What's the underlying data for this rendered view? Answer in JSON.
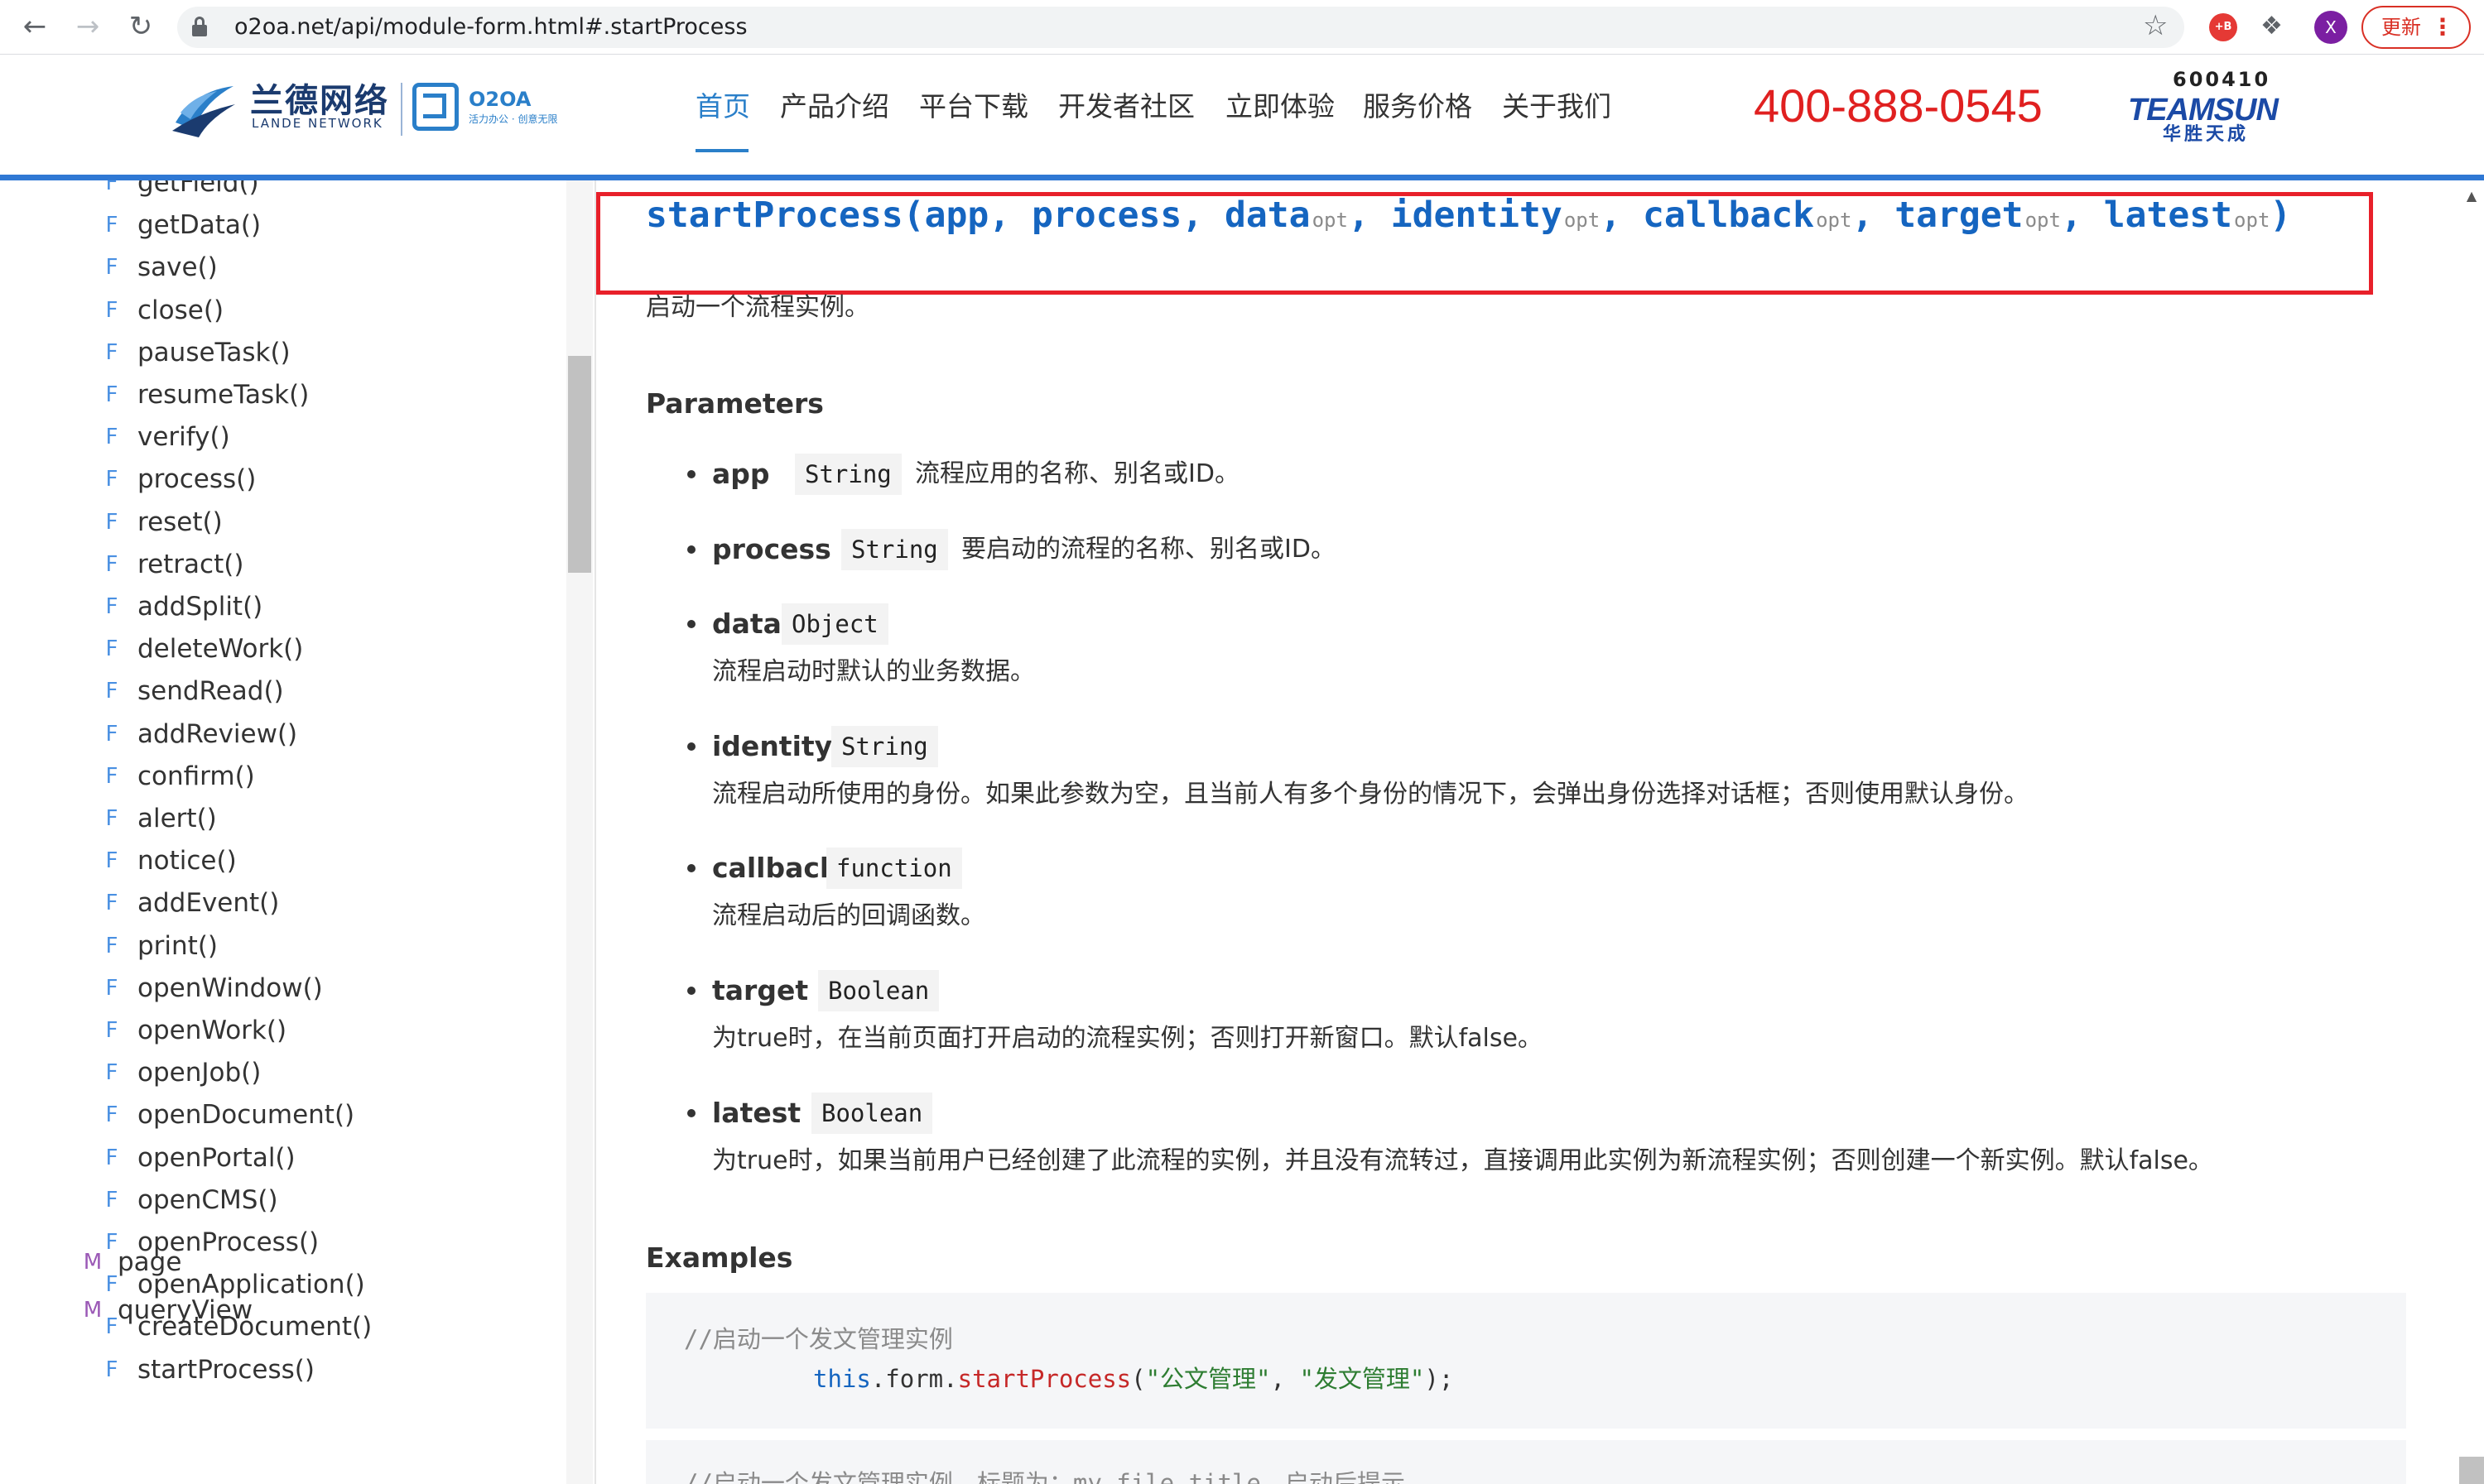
{
  "browser": {
    "url": "o2oa.net/api/module-form.html#.startProcess",
    "update_label": "更新",
    "profile_initial": "X",
    "extension_badge": "+B"
  },
  "site": {
    "logo_cn": "兰德网络",
    "logo_en": "LANDE NETWORK",
    "o2oa_name": "O2OA",
    "o2oa_tagline": "活力办公 · 创意无限",
    "nav": [
      "首页",
      "产品介绍",
      "平台下载",
      "开发者社区",
      "立即体验",
      "服务价格",
      "关于我们"
    ],
    "nav_active_index": 0,
    "phone": "400-888-0545",
    "partner_code": "600410",
    "partner_name": "TEAMSUN",
    "partner_name_cn": "华胜天成",
    "accent_color": "#2a7fc9",
    "phone_color": "#e02020"
  },
  "sidebar": {
    "functions": [
      "getField()",
      "getData()",
      "save()",
      "close()",
      "pauseTask()",
      "resumeTask()",
      "verify()",
      "process()",
      "reset()",
      "retract()",
      "addSplit()",
      "deleteWork()",
      "sendRead()",
      "addReview()",
      "confirm()",
      "alert()",
      "notice()",
      "addEvent()",
      "print()",
      "openWindow()",
      "openWork()",
      "openJob()",
      "openDocument()",
      "openPortal()",
      "openCMS()",
      "openProcess()",
      "openApplication()",
      "createDocument()",
      "startProcess()"
    ],
    "function_badge": "F",
    "modules": [
      "page",
      "queryView"
    ],
    "module_badge": "M"
  },
  "content": {
    "signature": {
      "name": "startProcess",
      "open": "(",
      "close": ")",
      "params": [
        {
          "name": "app",
          "opt": false
        },
        {
          "name": "process",
          "opt": false
        },
        {
          "name": "data",
          "opt": true
        },
        {
          "name": "identity",
          "opt": true
        },
        {
          "name": "callback",
          "opt": true
        },
        {
          "name": "target",
          "opt": true
        },
        {
          "name": "latest",
          "opt": true
        }
      ],
      "opt_label": "opt"
    },
    "summary": "启动一个流程实例。",
    "parameters_title": "Parameters",
    "parameters": [
      {
        "name": "app",
        "type": "String",
        "desc": "流程应用的名称、别名或ID。",
        "inline": true
      },
      {
        "name": "process",
        "type": "String",
        "desc": "要启动的流程的名称、别名或ID。",
        "inline": true
      },
      {
        "name": "data",
        "type": "Object",
        "desc": "流程启动时默认的业务数据。",
        "inline": false
      },
      {
        "name": "identity",
        "type": "String",
        "desc": "流程启动所使用的身份。如果此参数为空，且当前人有多个身份的情况下，会弹出身份选择对话框；否则使用默认身份。",
        "inline": false
      },
      {
        "name": "callback",
        "type": "function",
        "desc": "流程启动后的回调函数。",
        "inline": false
      },
      {
        "name": "target",
        "type": "Boolean",
        "desc": "为true时，在当前页面打开启动的流程实例；否则打开新窗口。默认false。",
        "inline": false
      },
      {
        "name": "latest",
        "type": "Boolean",
        "desc": "为true时，如果当前用户已经创建了此流程的实例，并且没有流转过，直接调用此实例为新流程实例；否则创建一个新实例。默认false。",
        "inline": false
      }
    ],
    "examples_title": "Examples",
    "example": {
      "comment": "//启动一个发文管理实例",
      "code_this": "this",
      "code_form": ".form.",
      "code_fn": "startProcess",
      "code_args_open": "(",
      "code_arg1": "\"公文管理\"",
      "code_sep": ", ",
      "code_arg2": "\"发文管理\"",
      "code_args_close": ");"
    },
    "example2_comment": "//启动一个发文管理实例，标题为：my file title，启动后提示",
    "highlight_color": "#e8202a"
  }
}
